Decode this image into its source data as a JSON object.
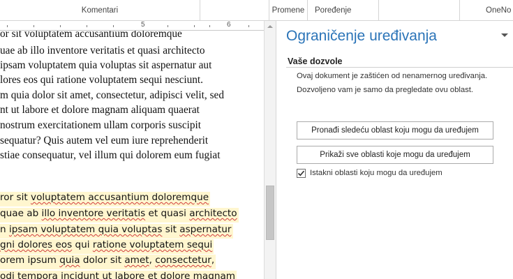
{
  "ribbon": {
    "groups": [
      "Komentari",
      "Promene",
      "Poređenje",
      "OneNo"
    ]
  },
  "ruler": {
    "numbers": [
      "5",
      "6"
    ]
  },
  "document": {
    "lines": [
      "or sit voluptatem accusantium doloremque",
      "uae ab illo inventore veritatis et quasi architecto",
      " ipsam voluptatem quia voluptas sit aspernatur aut",
      "lores eos qui ratione voluptatem sequi nesciunt.",
      "m quia dolor sit amet, consectetur, adipisci velit, sed",
      "nt ut labore et dolore magnam aliquam quaerat",
      " nostrum exercitationem ullam corporis suscipit",
      "sequatur? Quis autem vel eum iure reprehenderit",
      "stiae consequatur, vel illum qui dolorem eum fugiat"
    ],
    "highlighted_lines": [
      [
        {
          "t": "ror sit ",
          "s": false
        },
        {
          "t": "voluptatem accusantium doloremque",
          "s": true
        }
      ],
      [
        {
          "t": "quae ab ",
          "s": false
        },
        {
          "t": "illo inventore veritatis",
          "s": true
        },
        {
          "t": " et quasi ",
          "s": false
        },
        {
          "t": "architecto",
          "s": true
        }
      ],
      [
        {
          "t": "n ",
          "s": false
        },
        {
          "t": "ipsam voluptatem quia voluptas",
          "s": true
        },
        {
          "t": " sit ",
          "s": false
        },
        {
          "t": "aspernatur",
          "s": true
        }
      ],
      [
        {
          "t": "gni dolores eos",
          "s": true
        },
        {
          "t": " qui ",
          "s": false
        },
        {
          "t": "ratione voluptatem sequi",
          "s": true
        }
      ],
      [
        {
          "t": "orem ipsum ",
          "s": false
        },
        {
          "t": "quia",
          "s": true
        },
        {
          "t": " dolor sit ",
          "s": false
        },
        {
          "t": "amet",
          "s": true
        },
        {
          "t": ", ",
          "s": false
        },
        {
          "t": "consectetur",
          "s": true
        },
        {
          "t": ",",
          "s": false
        }
      ],
      [
        {
          "t": "odi tempora incidunt",
          "s": true
        },
        {
          "t": " ut labore et dolore ",
          "s": false
        },
        {
          "t": "magnam",
          "s": true
        }
      ]
    ]
  },
  "pane": {
    "title": "Ograničenje uređivanja",
    "section_heading": "Vaše dozvole",
    "info": [
      "Ovaj dokument je zaštićen od nenamernog uređivanja.",
      "Dozvoljeno vam je samo da pregledate ovu oblast."
    ],
    "find_next_button": "Pronađi sledeću oblast koju mogu da uređujem",
    "show_all_button": "Prikaži sve oblasti koje mogu da uređujem",
    "highlight_checkbox": {
      "label": "Istakni oblasti koju mogu da uređujem",
      "checked": true
    }
  },
  "colors": {
    "pane_title": "#2b74b8",
    "highlight_bg": "#fff6cf",
    "squiggle": "#d23d3d"
  }
}
